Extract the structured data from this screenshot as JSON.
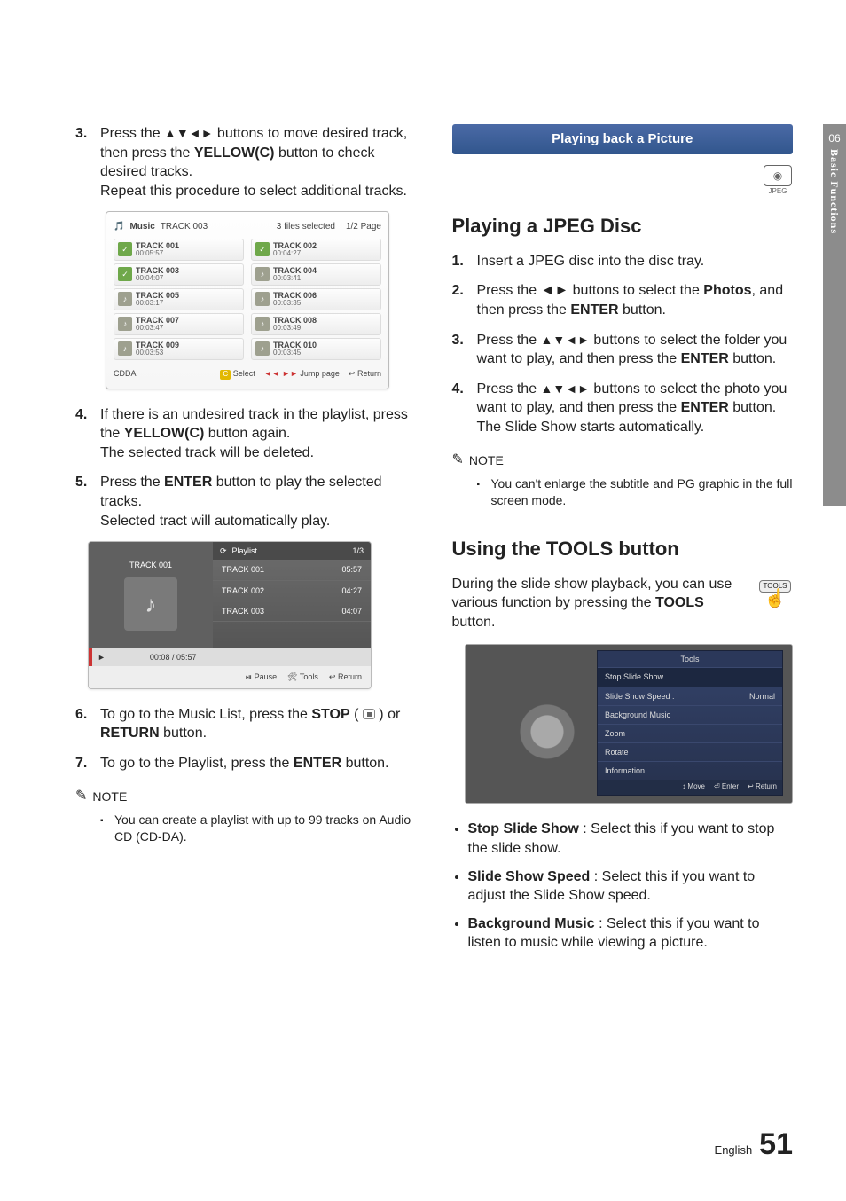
{
  "sidetab": {
    "chapter": "06",
    "title": "Basic Functions"
  },
  "left": {
    "step3": {
      "num": "3.",
      "t1": "Press the ",
      "arrows": "▲▼◄►",
      "t2": " buttons to move desired track, then press the ",
      "yellow": "YELLOW(C)",
      "t3": " button to check desired tracks.",
      "rep": "Repeat this procedure to select additional tracks."
    },
    "mock1": {
      "app": "Music",
      "cur": "TRACK 003",
      "sel": "3 files selected",
      "page": "1/2 Page",
      "tracks": [
        {
          "n": "TRACK 001",
          "d": "00:05:57",
          "c": true
        },
        {
          "n": "TRACK 002",
          "d": "00:04:27",
          "c": true
        },
        {
          "n": "TRACK 003",
          "d": "00:04:07",
          "c": true
        },
        {
          "n": "TRACK 004",
          "d": "00:03:41",
          "c": false
        },
        {
          "n": "TRACK 005",
          "d": "00:03:17",
          "c": false
        },
        {
          "n": "TRACK 006",
          "d": "00:03:35",
          "c": false
        },
        {
          "n": "TRACK 007",
          "d": "00:03:47",
          "c": false
        },
        {
          "n": "TRACK 008",
          "d": "00:03:49",
          "c": false
        },
        {
          "n": "TRACK 009",
          "d": "00:03:53",
          "c": false
        },
        {
          "n": "TRACK 010",
          "d": "00:03:45",
          "c": false
        }
      ],
      "src": "CDDA",
      "leg_select": "Select",
      "leg_jump": "Jump page",
      "leg_return": "Return"
    },
    "step4": {
      "num": "4.",
      "t1": "If there is an undesired track in the playlist, press the ",
      "yellow": "YELLOW(C)",
      "t2": " button again.",
      "t3": "The selected track will be deleted."
    },
    "step5": {
      "num": "5.",
      "t1": "Press the ",
      "enter": "ENTER",
      "t2": " button to play the selected tracks.",
      "t3": "Selected tract will automatically play."
    },
    "mock2": {
      "hdr": "Playlist",
      "pg": "1/3",
      "curtrack": "TRACK 001",
      "timebar": "00:08 / 05:57",
      "rows": [
        {
          "n": "TRACK 001",
          "d": "05:57"
        },
        {
          "n": "TRACK 002",
          "d": "04:27"
        },
        {
          "n": "TRACK 003",
          "d": "04:07"
        }
      ],
      "pause": "Pause",
      "tools": "Tools",
      "return": "Return"
    },
    "step6": {
      "num": "6.",
      "t1": "To go to the Music List, press the ",
      "stop": "STOP",
      "t2": " ( ",
      "t3": " ) or ",
      "ret": "RETURN",
      "t4": " button."
    },
    "step7": {
      "num": "7.",
      "t1": "To go to the Playlist, press the ",
      "enter": "ENTER",
      "t2": " button."
    },
    "note_hd": "NOTE",
    "note1": "You can create a playlist with up to 99 tracks on Audio CD (CD-DA)."
  },
  "right": {
    "section": "Playing back a Picture",
    "jpeg_label": "JPEG",
    "h2a": "Playing a JPEG Disc",
    "s1": {
      "num": "1.",
      "t": "Insert a JPEG disc into the disc tray."
    },
    "s2": {
      "num": "2.",
      "t1": "Press the ",
      "arrows": "◄►",
      "t2": " buttons to select the ",
      "photos": "Photos",
      "t3": ", and then press the ",
      "enter": "ENTER",
      "t4": " button."
    },
    "s3": {
      "num": "3.",
      "t1": "Press the ",
      "arrows": "▲▼◄►",
      "t2": " buttons to select the folder you want to play, and then press the ",
      "enter": "ENTER",
      "t3": " button."
    },
    "s4": {
      "num": "4.",
      "t1": "Press the ",
      "arrows": "▲▼◄►",
      "t2": " buttons to select the photo you want to play, and then press the ",
      "enter": "ENTER",
      "t3": " button.",
      "t4": "The Slide Show starts automatically."
    },
    "note_hd": "NOTE",
    "note1": "You can't enlarge the subtitle and PG graphic in the full screen mode.",
    "h2b": "Using the TOOLS button",
    "tools_p1": "During the slide show playback, you can use various function by pressing the ",
    "tools_b": "TOOLS",
    "tools_p2": " button.",
    "tools_btn": "TOOLS",
    "toolsmenu": {
      "title": "Tools",
      "items": [
        {
          "l": "Stop Slide Show",
          "r": ""
        },
        {
          "l": "Slide Show Speed :",
          "r": "Normal"
        },
        {
          "l": "Background Music",
          "r": ""
        },
        {
          "l": "Zoom",
          "r": ""
        },
        {
          "l": "Rotate",
          "r": ""
        },
        {
          "l": "Information",
          "r": ""
        }
      ],
      "f_move": "Move",
      "f_enter": "Enter",
      "f_return": "Return"
    },
    "bullets": [
      {
        "b": "Stop Slide Show",
        "t": " : Select this if you want to stop the slide show."
      },
      {
        "b": "Slide Show Speed",
        "t": " : Select this if you want to adjust the Slide Show speed."
      },
      {
        "b": "Background Music",
        "t": " : Select this if you want to listen to music while viewing a picture."
      }
    ]
  },
  "footer": {
    "lang": "English",
    "page": "51"
  }
}
